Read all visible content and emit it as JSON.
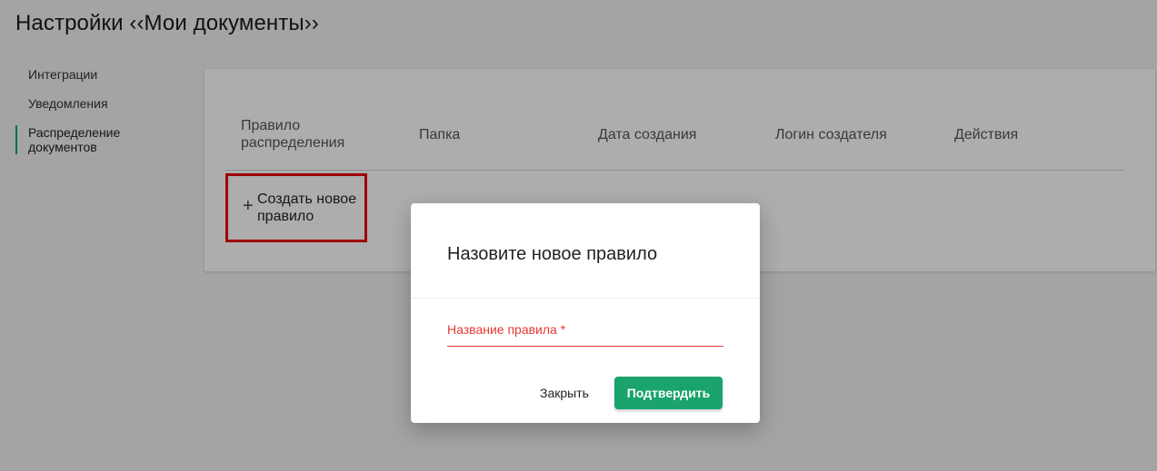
{
  "page": {
    "title": "Настройки ‹‹Мои документы››"
  },
  "sidebar": {
    "items": [
      {
        "label": "Интеграции",
        "active": false
      },
      {
        "label": "Уведомления",
        "active": false
      },
      {
        "label": "Распределение документов",
        "active": true
      }
    ]
  },
  "table": {
    "columns": [
      "Правило распределения",
      "Папка",
      "Дата создания",
      "Логин создателя",
      "Действия"
    ],
    "rows": []
  },
  "create_rule": {
    "icon": "plus-icon",
    "label": "Создать новое правило"
  },
  "dialog": {
    "title": "Назовите новое правило",
    "field_label": "Название правила *",
    "field_value": "",
    "close_label": "Закрыть",
    "confirm_label": "Подтвердить"
  },
  "colors": {
    "accent": "#1aa36b",
    "error": "#e53935",
    "highlight_border": "#e8000b"
  }
}
